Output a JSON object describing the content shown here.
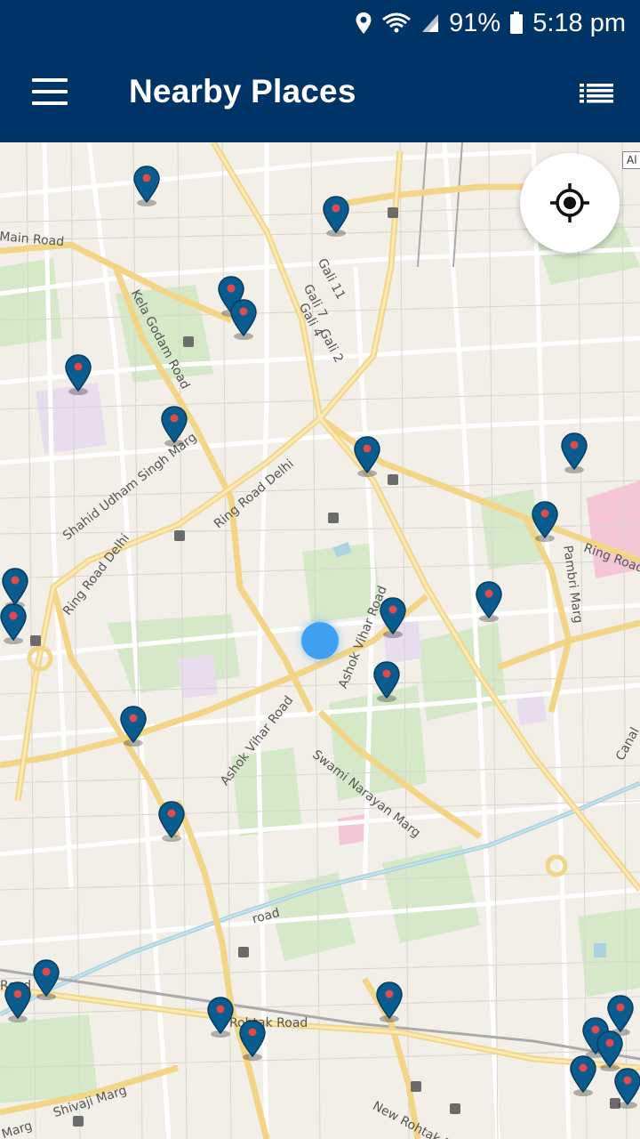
{
  "status_bar": {
    "location_icon": "location-pin-icon",
    "wifi_icon": "wifi-icon",
    "signal_icon": "cell-signal-icon",
    "battery_percent": "91%",
    "battery_icon": "battery-icon",
    "time": "5:18 pm"
  },
  "app_bar": {
    "menu_icon": "hamburger-menu-icon",
    "title": "Nearby Places",
    "list_icon": "list-view-icon",
    "background": "#003366"
  },
  "map": {
    "locate_button_icon": "my-location-icon",
    "scale_tag": "Al",
    "pin_color": "#0a5c8f",
    "pin_dot_color": "#e34b4b",
    "user_dot_color": "#3ea0f3",
    "street_labels": [
      "Main Road",
      "Kela Godam Road",
      "Gali 11",
      "Gali 7",
      "Gali 4",
      "Gali 2",
      "Shahid Udham Singh Marg",
      "Ring Road Delhi",
      "Ring Road Delhi",
      "Ring Road",
      "Pambri Marg",
      "Ashok Vihar Road",
      "Ashok Vihar Road",
      "Swami Narayan Marg",
      "road",
      "Rohtak Road",
      "Shivaji Marg",
      "Marg",
      "New Rohtak Road",
      "Canal",
      "Road"
    ],
    "pin_count": 30
  }
}
